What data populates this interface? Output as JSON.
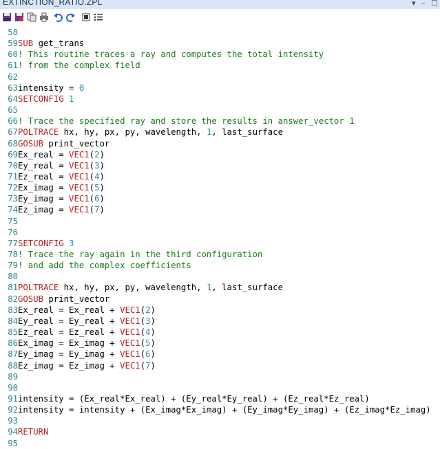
{
  "window": {
    "title": "EXTINCTION_RATIO.ZPL",
    "dropdown_glyph": "▾",
    "minimize_glyph": "–",
    "maximize_glyph": "☐"
  },
  "toolbar": {
    "icons": [
      "save-icon",
      "save-as-icon",
      "copy-icon",
      "print-icon",
      "undo-icon",
      "redo-icon",
      "stop-icon",
      "list-icon"
    ]
  },
  "colors": {
    "keyword": "#b22222",
    "comment": "#1b7b1b",
    "number": "#2a8aa8",
    "line_number": "#2d8a8a"
  },
  "editor": {
    "lines": [
      {
        "n": "58",
        "segs": []
      },
      {
        "n": "59",
        "segs": [
          {
            "t": "kw",
            "v": "SUB"
          },
          {
            "t": "tx",
            "v": " get_trans"
          }
        ]
      },
      {
        "n": "60",
        "segs": [
          {
            "t": "cm",
            "v": "! This routine traces a ray and computes the total intensity"
          }
        ]
      },
      {
        "n": "61",
        "segs": [
          {
            "t": "cm",
            "v": "! from the complex field"
          }
        ]
      },
      {
        "n": "62",
        "segs": []
      },
      {
        "n": "63",
        "segs": [
          {
            "t": "tx",
            "v": "intensity = "
          },
          {
            "t": "num",
            "v": "0"
          }
        ]
      },
      {
        "n": "64",
        "segs": [
          {
            "t": "kw",
            "v": "SETCONFIG"
          },
          {
            "t": "tx",
            "v": " "
          },
          {
            "t": "num",
            "v": "1"
          }
        ]
      },
      {
        "n": "65",
        "segs": []
      },
      {
        "n": "66",
        "segs": [
          {
            "t": "cm",
            "v": "! Trace the specified ray and store the results in answer_vector 1"
          }
        ]
      },
      {
        "n": "67",
        "segs": [
          {
            "t": "kw",
            "v": "POLTRACE"
          },
          {
            "t": "tx",
            "v": " hx, hy, px, py, wavelength, "
          },
          {
            "t": "num",
            "v": "1"
          },
          {
            "t": "tx",
            "v": ", last_surface"
          }
        ]
      },
      {
        "n": "68",
        "segs": [
          {
            "t": "kw",
            "v": "GOSUB"
          },
          {
            "t": "tx",
            "v": " print_vector"
          }
        ]
      },
      {
        "n": "69",
        "segs": [
          {
            "t": "tx",
            "v": "Ex_real = "
          },
          {
            "t": "vec",
            "v": "VEC1"
          },
          {
            "t": "tx",
            "v": "("
          },
          {
            "t": "num",
            "v": "2"
          },
          {
            "t": "tx",
            "v": ")"
          }
        ]
      },
      {
        "n": "70",
        "segs": [
          {
            "t": "tx",
            "v": "Ey_real = "
          },
          {
            "t": "vec",
            "v": "VEC1"
          },
          {
            "t": "tx",
            "v": "("
          },
          {
            "t": "num",
            "v": "3"
          },
          {
            "t": "tx",
            "v": ")"
          }
        ]
      },
      {
        "n": "71",
        "segs": [
          {
            "t": "tx",
            "v": "Ez_real = "
          },
          {
            "t": "vec",
            "v": "VEC1"
          },
          {
            "t": "tx",
            "v": "("
          },
          {
            "t": "num",
            "v": "4"
          },
          {
            "t": "tx",
            "v": ")"
          }
        ]
      },
      {
        "n": "72",
        "segs": [
          {
            "t": "tx",
            "v": "Ex_imag = "
          },
          {
            "t": "vec",
            "v": "VEC1"
          },
          {
            "t": "tx",
            "v": "("
          },
          {
            "t": "num",
            "v": "5"
          },
          {
            "t": "tx",
            "v": ")"
          }
        ]
      },
      {
        "n": "73",
        "segs": [
          {
            "t": "tx",
            "v": "Ey_imag = "
          },
          {
            "t": "vec",
            "v": "VEC1"
          },
          {
            "t": "tx",
            "v": "("
          },
          {
            "t": "num",
            "v": "6"
          },
          {
            "t": "tx",
            "v": ")"
          }
        ]
      },
      {
        "n": "74",
        "segs": [
          {
            "t": "tx",
            "v": "Ez_imag = "
          },
          {
            "t": "vec",
            "v": "VEC1"
          },
          {
            "t": "tx",
            "v": "("
          },
          {
            "t": "num",
            "v": "7"
          },
          {
            "t": "tx",
            "v": ")"
          }
        ]
      },
      {
        "n": "75",
        "segs": []
      },
      {
        "n": "76",
        "segs": []
      },
      {
        "n": "77",
        "segs": [
          {
            "t": "kw",
            "v": "SETCONFIG"
          },
          {
            "t": "tx",
            "v": " "
          },
          {
            "t": "num",
            "v": "3"
          }
        ]
      },
      {
        "n": "78",
        "segs": [
          {
            "t": "cm",
            "v": "! Trace the ray again in the third configuration"
          }
        ]
      },
      {
        "n": "79",
        "segs": [
          {
            "t": "cm",
            "v": "! and add the complex coefficients"
          }
        ]
      },
      {
        "n": "80",
        "segs": []
      },
      {
        "n": "81",
        "segs": [
          {
            "t": "kw",
            "v": "POLTRACE"
          },
          {
            "t": "tx",
            "v": " hx, hy, px, py, wavelength, "
          },
          {
            "t": "num",
            "v": "1"
          },
          {
            "t": "tx",
            "v": ", last_surface"
          }
        ]
      },
      {
        "n": "82",
        "segs": [
          {
            "t": "kw",
            "v": "GOSUB"
          },
          {
            "t": "tx",
            "v": " print_vector"
          }
        ]
      },
      {
        "n": "83",
        "segs": [
          {
            "t": "tx",
            "v": "Ex_real = Ex_real + "
          },
          {
            "t": "vec",
            "v": "VEC1"
          },
          {
            "t": "tx",
            "v": "("
          },
          {
            "t": "num",
            "v": "2"
          },
          {
            "t": "tx",
            "v": ")"
          }
        ]
      },
      {
        "n": "84",
        "segs": [
          {
            "t": "tx",
            "v": "Ey_real = Ey_real + "
          },
          {
            "t": "vec",
            "v": "VEC1"
          },
          {
            "t": "tx",
            "v": "("
          },
          {
            "t": "num",
            "v": "3"
          },
          {
            "t": "tx",
            "v": ")"
          }
        ]
      },
      {
        "n": "85",
        "segs": [
          {
            "t": "tx",
            "v": "Ez_real = Ez_real + "
          },
          {
            "t": "vec",
            "v": "VEC1"
          },
          {
            "t": "tx",
            "v": "("
          },
          {
            "t": "num",
            "v": "4"
          },
          {
            "t": "tx",
            "v": ")"
          }
        ]
      },
      {
        "n": "86",
        "segs": [
          {
            "t": "tx",
            "v": "Ex_imag = Ex_imag + "
          },
          {
            "t": "vec",
            "v": "VEC1"
          },
          {
            "t": "tx",
            "v": "("
          },
          {
            "t": "num",
            "v": "5"
          },
          {
            "t": "tx",
            "v": ")"
          }
        ]
      },
      {
        "n": "87",
        "segs": [
          {
            "t": "tx",
            "v": "Ey_imag = Ey_imag + "
          },
          {
            "t": "vec",
            "v": "VEC1"
          },
          {
            "t": "tx",
            "v": "("
          },
          {
            "t": "num",
            "v": "6"
          },
          {
            "t": "tx",
            "v": ")"
          }
        ]
      },
      {
        "n": "88",
        "segs": [
          {
            "t": "tx",
            "v": "Ez_imag = Ez_imag + "
          },
          {
            "t": "vec",
            "v": "VEC1"
          },
          {
            "t": "tx",
            "v": "("
          },
          {
            "t": "num",
            "v": "7"
          },
          {
            "t": "tx",
            "v": ")"
          }
        ]
      },
      {
        "n": "89",
        "segs": []
      },
      {
        "n": "90",
        "segs": []
      },
      {
        "n": "91",
        "segs": [
          {
            "t": "tx",
            "v": "intensity = (Ex_real*Ex_real) + (Ey_real*Ey_real) + (Ez_real*Ez_real)"
          }
        ]
      },
      {
        "n": "92",
        "segs": [
          {
            "t": "tx",
            "v": "intensity = intensity + (Ex_imag*Ex_imag) + (Ey_imag*Ey_imag) + (Ez_imag*Ez_imag)"
          }
        ]
      },
      {
        "n": "93",
        "segs": []
      },
      {
        "n": "94",
        "segs": [
          {
            "t": "kw",
            "v": "RETURN"
          }
        ]
      },
      {
        "n": "95",
        "segs": []
      }
    ]
  }
}
